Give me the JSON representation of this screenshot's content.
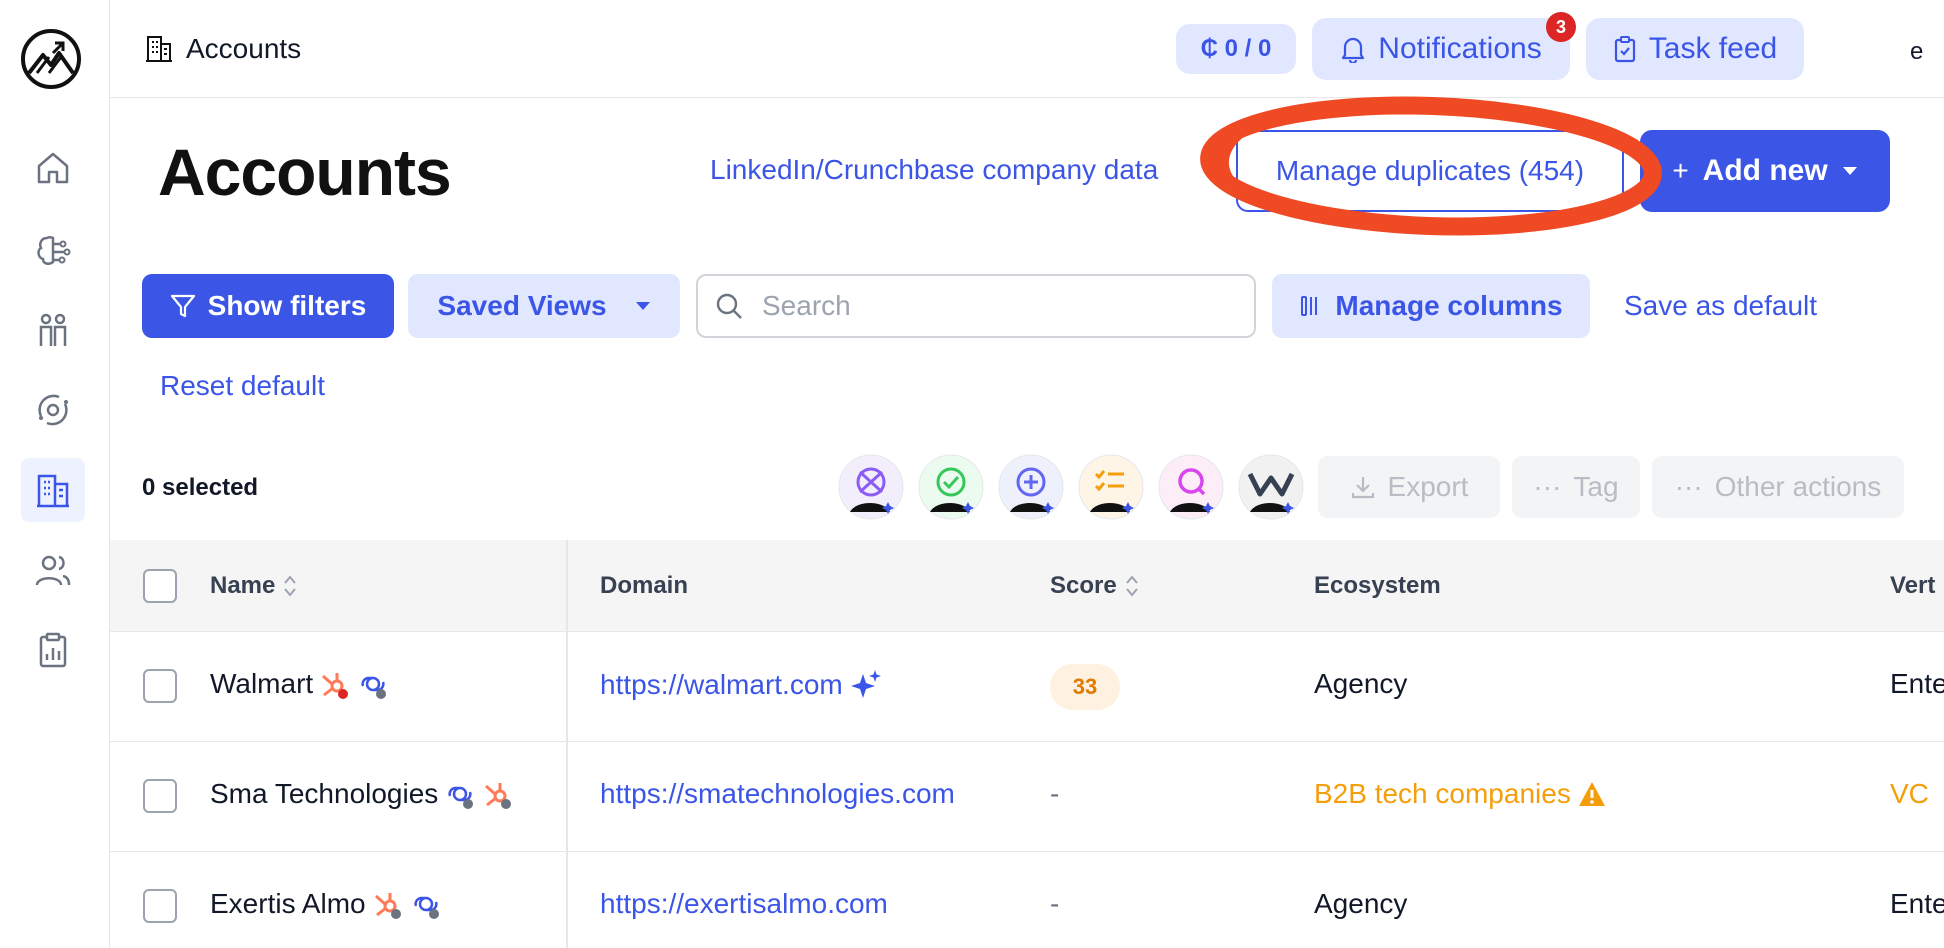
{
  "topbar": {
    "breadcrumb": "Accounts",
    "credits": "₵ 0 / 0",
    "notifications_label": "Notifications",
    "notifications_count": "3",
    "task_feed_label": "Task feed",
    "edge_text": "e"
  },
  "header": {
    "title": "Accounts",
    "company_data_link": "LinkedIn/Crunchbase company data",
    "manage_duplicates": "Manage duplicates (454)",
    "add_new": "Add new"
  },
  "filters": {
    "show_filters": "Show filters",
    "saved_views": "Saved Views",
    "search_placeholder": "Search",
    "manage_columns": "Manage columns",
    "save_as_default": "Save as default",
    "reset_default": "Reset default"
  },
  "selection": {
    "selected_count": "0 selected",
    "export": "Export",
    "tag": "Tag",
    "other_actions": "Other actions"
  },
  "table": {
    "columns": [
      "Name",
      "Domain",
      "Score",
      "Ecosystem",
      "Vert"
    ],
    "rows": [
      {
        "name": "Walmart",
        "domain": "https://walmart.com",
        "score": "33",
        "ecosystem": "Agency",
        "vertical": "Ente"
      },
      {
        "name": "Sma Technologies",
        "domain": "https://smatechnologies.com",
        "score": "-",
        "ecosystem": "B2B tech companies",
        "vertical": "VC"
      },
      {
        "name": "Exertis Almo",
        "domain": "https://exertisalmo.com",
        "score": "-",
        "ecosystem": "Agency",
        "vertical": "Ente"
      }
    ]
  },
  "colors": {
    "accent": "#3b55e6",
    "accent_light": "#e0e7ff",
    "annotation": "#f04a24",
    "warning": "#f59e0b",
    "hubspot": "#ff7a59",
    "badge": "#dc2626"
  },
  "icons": {
    "sidebar": [
      "logo-icon",
      "home-icon",
      "brain-icon",
      "people-icon",
      "orbit-icon",
      "building-icon",
      "users-icon",
      "clipboard-icon"
    ],
    "integrations": [
      "globe-ai-icon",
      "check-ai-icon",
      "plus-ai-icon",
      "list-ai-icon",
      "search-ai-icon",
      "w-ai-icon"
    ]
  }
}
